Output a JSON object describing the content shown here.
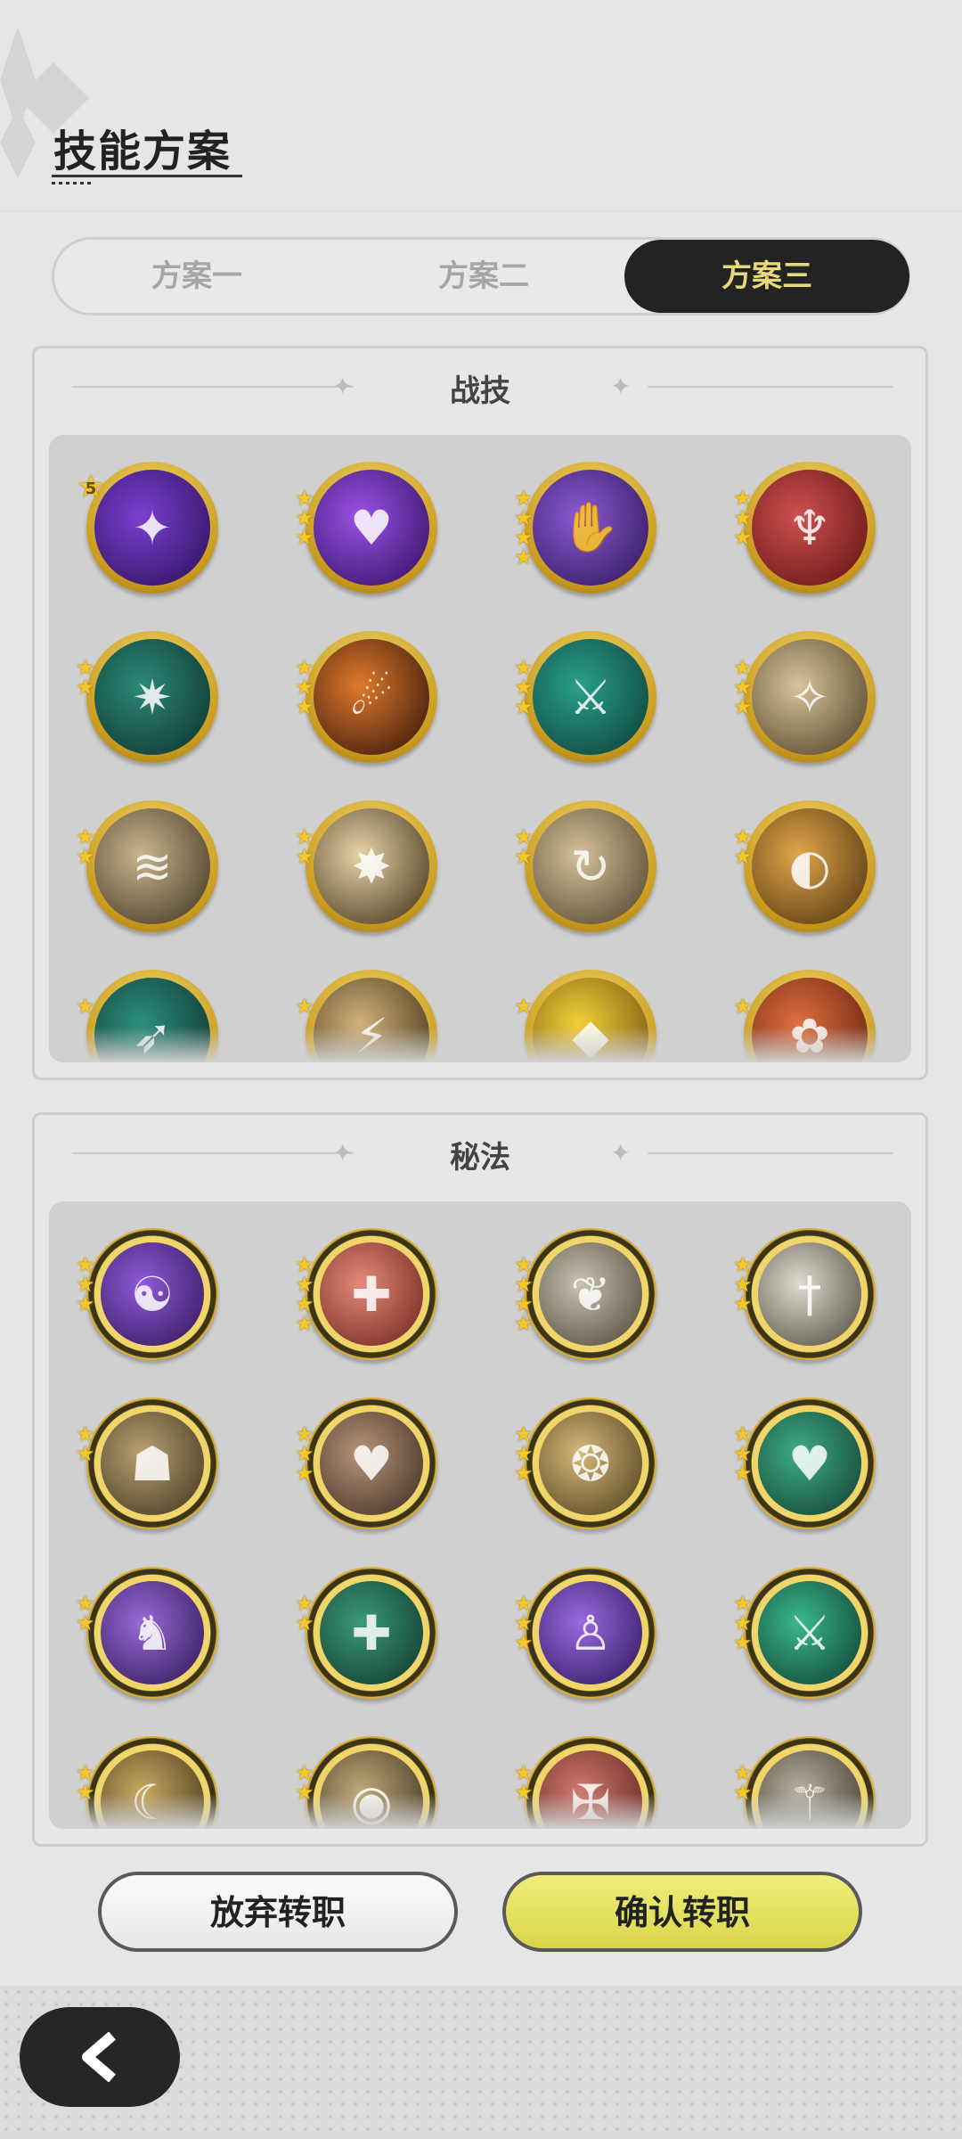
{
  "header": {
    "title": "技能方案"
  },
  "tabs": [
    {
      "label": "方案一",
      "active": false
    },
    {
      "label": "方案二",
      "active": false
    },
    {
      "label": "方案三",
      "active": true
    }
  ],
  "sections": {
    "combat": {
      "title": "战技",
      "icons": [
        {
          "name": "purple-orb-skill-icon",
          "stars": 0,
          "level": "5",
          "colors": [
            "#7a3fd1",
            "#2a0f55"
          ],
          "glyph": "✦"
        },
        {
          "name": "purple-heart-burst-skill-icon",
          "stars": 3,
          "colors": [
            "#9a52e6",
            "#2d0d5a"
          ],
          "glyph": "♥"
        },
        {
          "name": "purple-claw-skill-icon",
          "stars": 4,
          "colors": [
            "#8b5ad6",
            "#2b1450"
          ],
          "glyph": "✋"
        },
        {
          "name": "red-figure-sword-skill-icon",
          "stars": 3,
          "colors": [
            "#d05050",
            "#5a1010"
          ],
          "glyph": "♆"
        },
        {
          "name": "green-web-skill-icon",
          "stars": 2,
          "colors": [
            "#2c8a78",
            "#0c2e29"
          ],
          "glyph": "✷"
        },
        {
          "name": "fire-slash-skill-icon",
          "stars": 3,
          "colors": [
            "#e07a2c",
            "#2a0f07"
          ],
          "glyph": "☄"
        },
        {
          "name": "green-sword-burst-skill-icon",
          "stars": 3,
          "colors": [
            "#2aa08c",
            "#0b3a33"
          ],
          "glyph": "⚔"
        },
        {
          "name": "gold-shield-burst-skill-icon",
          "stars": 3,
          "colors": [
            "#d8c39a",
            "#4a3b22"
          ],
          "glyph": "✧"
        },
        {
          "name": "wind-slash-skill-icon",
          "stars": 2,
          "colors": [
            "#cbb58f",
            "#3a2f1d"
          ],
          "glyph": "≋"
        },
        {
          "name": "light-explosion-skill-icon",
          "stars": 2,
          "colors": [
            "#e8d3a8",
            "#3a2a14"
          ],
          "glyph": "✸"
        },
        {
          "name": "spin-slash-skill-icon",
          "stars": 2,
          "colors": [
            "#d6c19a",
            "#4a3d28"
          ],
          "glyph": "↻"
        },
        {
          "name": "gold-crescent-skill-icon",
          "stars": 2,
          "colors": [
            "#e0a64a",
            "#4a2e0d"
          ],
          "glyph": "◐"
        },
        {
          "name": "teal-dash-skill-icon",
          "stars": 1,
          "colors": [
            "#2c8f7d",
            "#0d2c28"
          ],
          "glyph": "➶"
        },
        {
          "name": "gold-blade-skill-icon",
          "stars": 1,
          "colors": [
            "#d2b27a",
            "#3a2a12"
          ],
          "glyph": "⚡"
        },
        {
          "name": "yellow-crystal-skill-icon",
          "stars": 1,
          "colors": [
            "#f2d03a",
            "#6b4a0a"
          ],
          "glyph": "◆"
        },
        {
          "name": "red-flower-skill-icon",
          "stars": 1,
          "colors": [
            "#e07040",
            "#5a1a0a"
          ],
          "glyph": "✿"
        }
      ]
    },
    "secret": {
      "title": "秘法",
      "icons": [
        {
          "name": "purple-spirit-secret-icon",
          "stars": 3,
          "colors": [
            "#8f5ad9",
            "#2e1454"
          ],
          "glyph": "☯"
        },
        {
          "name": "red-sword-heal-secret-icon",
          "stars": 4,
          "colors": [
            "#e48a7a",
            "#6a2018"
          ],
          "glyph": "✚"
        },
        {
          "name": "silver-leaf-secret-icon",
          "stars": 4,
          "colors": [
            "#c9c2b0",
            "#4a4334"
          ],
          "glyph": "❦"
        },
        {
          "name": "silver-dagger-secret-icon",
          "stars": 3,
          "colors": [
            "#e0dbd0",
            "#4a4538"
          ],
          "glyph": "†"
        },
        {
          "name": "gold-guardian-secret-icon",
          "stars": 2,
          "colors": [
            "#b8a070",
            "#3e3220"
          ],
          "glyph": "☗"
        },
        {
          "name": "heart-shield-secret-icon",
          "stars": 3,
          "colors": [
            "#b89478",
            "#3a2a20"
          ],
          "glyph": "♥"
        },
        {
          "name": "gold-vortex-secret-icon",
          "stars": 3,
          "colors": [
            "#d6b878",
            "#4a3a1a"
          ],
          "glyph": "❂"
        },
        {
          "name": "green-heart-heal-secret-icon",
          "stars": 3,
          "colors": [
            "#3fae86",
            "#0f3a2c"
          ],
          "glyph": "♥"
        },
        {
          "name": "purple-beast-secret-icon",
          "stars": 2,
          "colors": [
            "#9a6ad8",
            "#2a1450"
          ],
          "glyph": "♞"
        },
        {
          "name": "green-heal-circle-secret-icon",
          "stars": 2,
          "colors": [
            "#3a9a78",
            "#0f3328"
          ],
          "glyph": "✚"
        },
        {
          "name": "purple-figure-secret-icon",
          "stars": 3,
          "colors": [
            "#9a6ae0",
            "#2a1456"
          ],
          "glyph": "♙"
        },
        {
          "name": "green-sword-secret-icon",
          "stars": 3,
          "colors": [
            "#3ab890",
            "#0c3a2c"
          ],
          "glyph": "⚔"
        },
        {
          "name": "gold-crescent-figure-secret-icon",
          "stars": 2,
          "colors": [
            "#c9a860",
            "#3e3018"
          ],
          "glyph": "☾"
        },
        {
          "name": "eye-secret-icon",
          "stars": 2,
          "colors": [
            "#c0a878",
            "#3a2e1c"
          ],
          "glyph": "◉"
        },
        {
          "name": "red-rune-secret-icon",
          "stars": 2,
          "colors": [
            "#d07a70",
            "#5a1e18"
          ],
          "glyph": "✠"
        },
        {
          "name": "silver-warrior-secret-icon",
          "stars": 2,
          "colors": [
            "#b8b0a0",
            "#3a3428"
          ],
          "glyph": "⚚"
        }
      ]
    }
  },
  "buttons": {
    "abandon": "放弃转职",
    "confirm": "确认转职"
  },
  "colors": {
    "accent": "#e7d87a",
    "confirm": "#e3e05a",
    "dark": "#232323"
  }
}
